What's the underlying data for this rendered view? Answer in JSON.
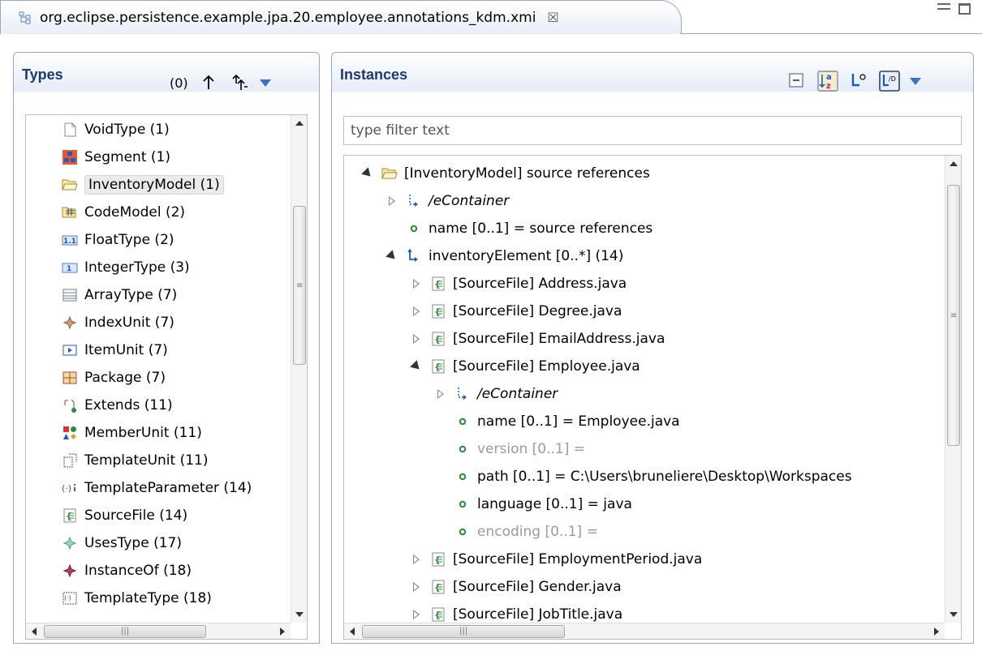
{
  "editor": {
    "tab_title": "org.eclipse.persistence.example.jpa.20.employee.annotations_kdm.xmi",
    "close_glyph": "☒"
  },
  "types_panel": {
    "title": "Types",
    "count": "(0)",
    "items": [
      {
        "label": "VoidType (1)",
        "icon": "void-type-icon"
      },
      {
        "label": "Segment (1)",
        "icon": "segment-icon"
      },
      {
        "label": "InventoryModel (1)",
        "icon": "folder-icon",
        "selected": true
      },
      {
        "label": "CodeModel (2)",
        "icon": "code-model-icon"
      },
      {
        "label": "FloatType (2)",
        "icon": "float-type-icon"
      },
      {
        "label": "IntegerType (3)",
        "icon": "integer-type-icon"
      },
      {
        "label": "ArrayType (7)",
        "icon": "array-type-icon"
      },
      {
        "label": "IndexUnit (7)",
        "icon": "index-unit-icon"
      },
      {
        "label": "ItemUnit (7)",
        "icon": "item-unit-icon"
      },
      {
        "label": "Package (7)",
        "icon": "package-icon"
      },
      {
        "label": "Extends (11)",
        "icon": "extends-icon"
      },
      {
        "label": "MemberUnit (11)",
        "icon": "member-unit-icon"
      },
      {
        "label": "TemplateUnit (11)",
        "icon": "template-unit-icon"
      },
      {
        "label": "TemplateParameter (14)",
        "icon": "template-parameter-icon"
      },
      {
        "label": "SourceFile (14)",
        "icon": "source-file-icon"
      },
      {
        "label": "UsesType (17)",
        "icon": "uses-type-icon"
      },
      {
        "label": "InstanceOf (18)",
        "icon": "instance-of-icon"
      },
      {
        "label": "TemplateType (18)",
        "icon": "template-type-icon"
      }
    ]
  },
  "instances_panel": {
    "title": "Instances",
    "filter_placeholder": "type filter text",
    "rows": [
      {
        "label": "[InventoryModel] source references",
        "twisty": "expanded",
        "icon": "folder-icon",
        "level": 0
      },
      {
        "label": "/eContainer",
        "twisty": "collapsed",
        "icon": "container-ref-icon",
        "level": 1,
        "italic": true
      },
      {
        "label": "name [0..1] = source references",
        "twisty": "none",
        "icon": "attribute-dot-icon",
        "level": 1
      },
      {
        "label": "inventoryElement [0..*] (14)",
        "twisty": "expanded",
        "icon": "reference-arrow-icon",
        "level": 1
      },
      {
        "label": "[SourceFile] Address.java",
        "twisty": "collapsed",
        "icon": "source-file-icon",
        "level": 2
      },
      {
        "label": "[SourceFile] Degree.java",
        "twisty": "collapsed",
        "icon": "source-file-icon",
        "level": 2
      },
      {
        "label": "[SourceFile] EmailAddress.java",
        "twisty": "collapsed",
        "icon": "source-file-icon",
        "level": 2
      },
      {
        "label": "[SourceFile] Employee.java",
        "twisty": "expanded",
        "icon": "source-file-icon",
        "level": 2
      },
      {
        "label": "/eContainer",
        "twisty": "collapsed",
        "icon": "container-ref-icon",
        "level": 3,
        "italic": true
      },
      {
        "label": "name [0..1] = Employee.java",
        "twisty": "none",
        "icon": "attribute-dot-icon",
        "level": 3
      },
      {
        "label": "version [0..1] =",
        "twisty": "none",
        "icon": "attribute-dot-icon",
        "level": 3,
        "gray": true
      },
      {
        "label": "path [0..1] = C:\\Users\\bruneliere\\Desktop\\Workspaces",
        "twisty": "none",
        "icon": "attribute-dot-icon",
        "level": 3
      },
      {
        "label": "language [0..1] = java",
        "twisty": "none",
        "icon": "attribute-dot-icon",
        "level": 3
      },
      {
        "label": "encoding [0..1] =",
        "twisty": "none",
        "icon": "attribute-dot-icon",
        "level": 3,
        "gray": true
      },
      {
        "label": "[SourceFile] EmploymentPeriod.java",
        "twisty": "collapsed",
        "icon": "source-file-icon",
        "level": 2
      },
      {
        "label": "[SourceFile] Gender.java",
        "twisty": "collapsed",
        "icon": "source-file-icon",
        "level": 2
      },
      {
        "label": "[SourceFile] JobTitle.java",
        "twisty": "collapsed",
        "icon": "source-file-icon",
        "level": 2
      }
    ]
  },
  "colors": {
    "header_title": "#1f3a6d",
    "accent_blue": "#3f6fbf",
    "attribute_green": "#2e8b3d",
    "border": "#9aa8c0"
  }
}
